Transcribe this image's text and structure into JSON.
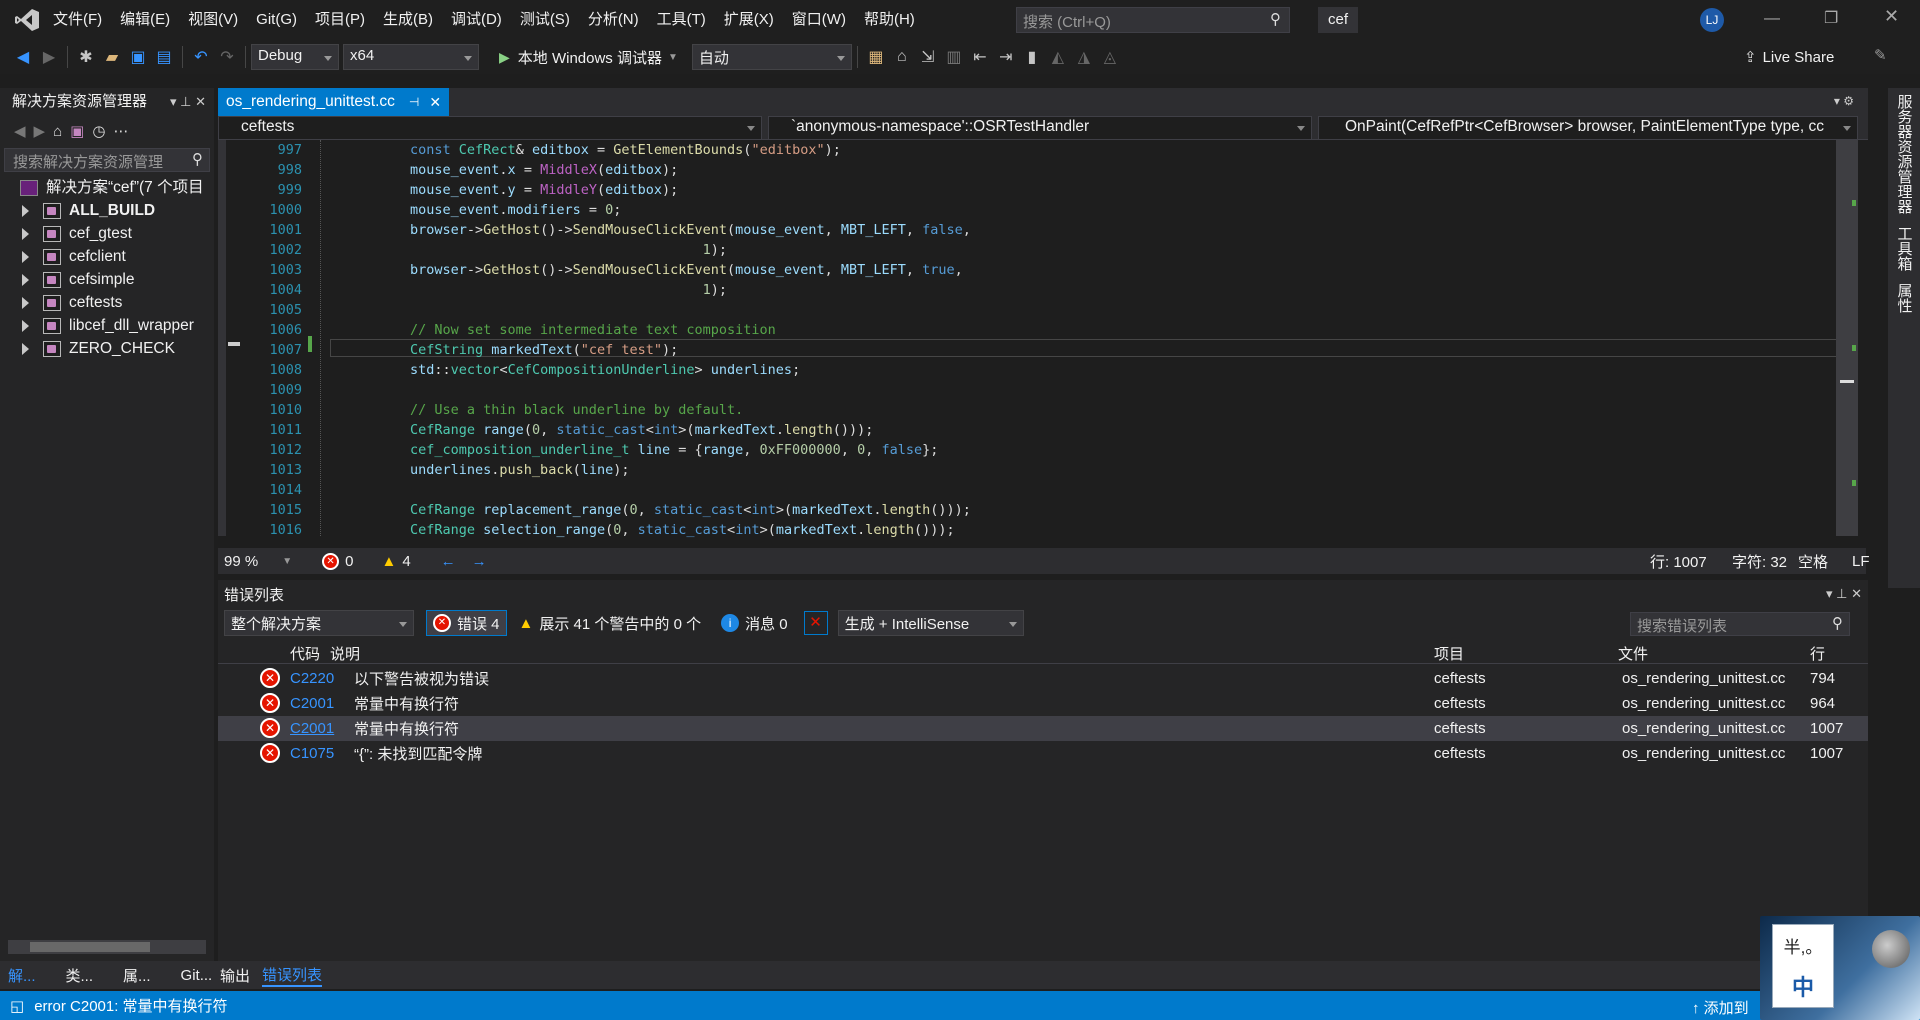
{
  "menu": [
    "文件(F)",
    "编辑(E)",
    "视图(V)",
    "Git(G)",
    "项目(P)",
    "生成(B)",
    "调试(D)",
    "测试(S)",
    "分析(N)",
    "工具(T)",
    "扩展(X)",
    "窗口(W)",
    "帮助(H)"
  ],
  "search_placeholder": "搜索 (Ctrl+Q)",
  "solution_badge": "cef",
  "avatar": "LJ",
  "toolbar": {
    "config": "Debug",
    "platform": "x64",
    "run_label": "本地 Windows 调试器",
    "auto": "自动",
    "live_share": "Live Share"
  },
  "solution_explorer": {
    "title": "解决方案资源管理器",
    "search_placeholder": "搜索解决方案资源管理",
    "solution": "解决方案“cef”(7 个项目",
    "projects": [
      "ALL_BUILD",
      "cef_gtest",
      "cefclient",
      "cefsimple",
      "ceftests",
      "libcef_dll_wrapper",
      "ZERO_CHECK"
    ]
  },
  "editor": {
    "tab": "os_rendering_unittest.cc",
    "nav1": "ceftests",
    "nav2": "`anonymous-namespace'::OSRTestHandler",
    "nav3": "OnPaint(CefRefPtr<CefBrowser> browser, PaintElementType type, cc",
    "zoom": "99 %",
    "errors": "0",
    "warnings": "4",
    "line": "行: 1007",
    "col": "字符: 32",
    "spaces": "空格",
    "eol": "LF"
  },
  "lines": [
    "997",
    "998",
    "999",
    "1000",
    "1001",
    "1002",
    "1003",
    "1004",
    "1005",
    "1006",
    "1007",
    "1008",
    "1009",
    "1010",
    "1011",
    "1012",
    "1013",
    "1014",
    "1015",
    "1016"
  ],
  "right_tabs": [
    "服务器资源管理器",
    "工具箱",
    "属性"
  ],
  "error_list": {
    "title": "错误列表",
    "scope": "整个解决方案",
    "errors_btn": "错误 4",
    "warnings_btn": "展示 41 个警告中的 0 个",
    "messages_btn": "消息 0",
    "build_filter": "生成 + IntelliSense",
    "search_placeholder": "搜索错误列表",
    "headers": [
      "代码",
      "说明",
      "项目",
      "文件",
      "行"
    ],
    "rows": [
      {
        "code": "C2220",
        "desc": "以下警告被视为错误",
        "project": "ceftests",
        "file": "os_rendering_unittest.cc",
        "line": "794"
      },
      {
        "code": "C2001",
        "desc": "常量中有换行符",
        "project": "ceftests",
        "file": "os_rendering_unittest.cc",
        "line": "964"
      },
      {
        "code": "C2001",
        "desc": "常量中有换行符",
        "project": "ceftests",
        "file": "os_rendering_unittest.cc",
        "line": "1007"
      },
      {
        "code": "C1075",
        "desc": "“{”: 未找到匹配令牌",
        "project": "ceftests",
        "file": "os_rendering_unittest.cc",
        "line": "1007"
      }
    ]
  },
  "bottom_tabs": {
    "left": [
      "解...",
      "类...",
      "属...",
      "Git..."
    ],
    "right": [
      "输出",
      "错误列表"
    ]
  },
  "status": {
    "message": "error C2001: 常量中有换行符",
    "right": "添加到",
    "ime1": "半,。",
    "ime2": "中"
  }
}
